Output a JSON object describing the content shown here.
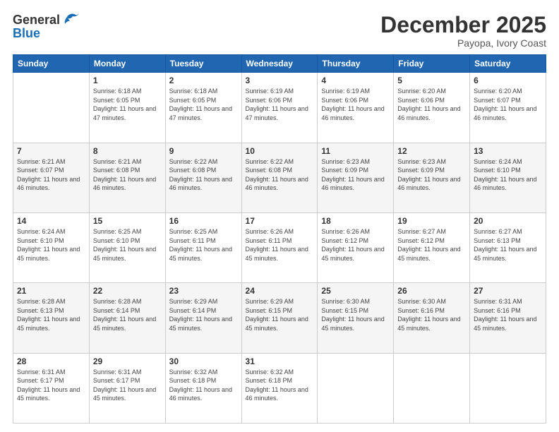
{
  "header": {
    "logo_general": "General",
    "logo_blue": "Blue",
    "month": "December 2025",
    "location": "Payopa, Ivory Coast"
  },
  "weekdays": [
    "Sunday",
    "Monday",
    "Tuesday",
    "Wednesday",
    "Thursday",
    "Friday",
    "Saturday"
  ],
  "weeks": [
    [
      {
        "day": "",
        "sunrise": "",
        "sunset": "",
        "daylight": ""
      },
      {
        "day": "1",
        "sunrise": "Sunrise: 6:18 AM",
        "sunset": "Sunset: 6:05 PM",
        "daylight": "Daylight: 11 hours and 47 minutes."
      },
      {
        "day": "2",
        "sunrise": "Sunrise: 6:18 AM",
        "sunset": "Sunset: 6:05 PM",
        "daylight": "Daylight: 11 hours and 47 minutes."
      },
      {
        "day": "3",
        "sunrise": "Sunrise: 6:19 AM",
        "sunset": "Sunset: 6:06 PM",
        "daylight": "Daylight: 11 hours and 47 minutes."
      },
      {
        "day": "4",
        "sunrise": "Sunrise: 6:19 AM",
        "sunset": "Sunset: 6:06 PM",
        "daylight": "Daylight: 11 hours and 46 minutes."
      },
      {
        "day": "5",
        "sunrise": "Sunrise: 6:20 AM",
        "sunset": "Sunset: 6:06 PM",
        "daylight": "Daylight: 11 hours and 46 minutes."
      },
      {
        "day": "6",
        "sunrise": "Sunrise: 6:20 AM",
        "sunset": "Sunset: 6:07 PM",
        "daylight": "Daylight: 11 hours and 46 minutes."
      }
    ],
    [
      {
        "day": "7",
        "sunrise": "Sunrise: 6:21 AM",
        "sunset": "Sunset: 6:07 PM",
        "daylight": "Daylight: 11 hours and 46 minutes."
      },
      {
        "day": "8",
        "sunrise": "Sunrise: 6:21 AM",
        "sunset": "Sunset: 6:08 PM",
        "daylight": "Daylight: 11 hours and 46 minutes."
      },
      {
        "day": "9",
        "sunrise": "Sunrise: 6:22 AM",
        "sunset": "Sunset: 6:08 PM",
        "daylight": "Daylight: 11 hours and 46 minutes."
      },
      {
        "day": "10",
        "sunrise": "Sunrise: 6:22 AM",
        "sunset": "Sunset: 6:08 PM",
        "daylight": "Daylight: 11 hours and 46 minutes."
      },
      {
        "day": "11",
        "sunrise": "Sunrise: 6:23 AM",
        "sunset": "Sunset: 6:09 PM",
        "daylight": "Daylight: 11 hours and 46 minutes."
      },
      {
        "day": "12",
        "sunrise": "Sunrise: 6:23 AM",
        "sunset": "Sunset: 6:09 PM",
        "daylight": "Daylight: 11 hours and 46 minutes."
      },
      {
        "day": "13",
        "sunrise": "Sunrise: 6:24 AM",
        "sunset": "Sunset: 6:10 PM",
        "daylight": "Daylight: 11 hours and 46 minutes."
      }
    ],
    [
      {
        "day": "14",
        "sunrise": "Sunrise: 6:24 AM",
        "sunset": "Sunset: 6:10 PM",
        "daylight": "Daylight: 11 hours and 45 minutes."
      },
      {
        "day": "15",
        "sunrise": "Sunrise: 6:25 AM",
        "sunset": "Sunset: 6:10 PM",
        "daylight": "Daylight: 11 hours and 45 minutes."
      },
      {
        "day": "16",
        "sunrise": "Sunrise: 6:25 AM",
        "sunset": "Sunset: 6:11 PM",
        "daylight": "Daylight: 11 hours and 45 minutes."
      },
      {
        "day": "17",
        "sunrise": "Sunrise: 6:26 AM",
        "sunset": "Sunset: 6:11 PM",
        "daylight": "Daylight: 11 hours and 45 minutes."
      },
      {
        "day": "18",
        "sunrise": "Sunrise: 6:26 AM",
        "sunset": "Sunset: 6:12 PM",
        "daylight": "Daylight: 11 hours and 45 minutes."
      },
      {
        "day": "19",
        "sunrise": "Sunrise: 6:27 AM",
        "sunset": "Sunset: 6:12 PM",
        "daylight": "Daylight: 11 hours and 45 minutes."
      },
      {
        "day": "20",
        "sunrise": "Sunrise: 6:27 AM",
        "sunset": "Sunset: 6:13 PM",
        "daylight": "Daylight: 11 hours and 45 minutes."
      }
    ],
    [
      {
        "day": "21",
        "sunrise": "Sunrise: 6:28 AM",
        "sunset": "Sunset: 6:13 PM",
        "daylight": "Daylight: 11 hours and 45 minutes."
      },
      {
        "day": "22",
        "sunrise": "Sunrise: 6:28 AM",
        "sunset": "Sunset: 6:14 PM",
        "daylight": "Daylight: 11 hours and 45 minutes."
      },
      {
        "day": "23",
        "sunrise": "Sunrise: 6:29 AM",
        "sunset": "Sunset: 6:14 PM",
        "daylight": "Daylight: 11 hours and 45 minutes."
      },
      {
        "day": "24",
        "sunrise": "Sunrise: 6:29 AM",
        "sunset": "Sunset: 6:15 PM",
        "daylight": "Daylight: 11 hours and 45 minutes."
      },
      {
        "day": "25",
        "sunrise": "Sunrise: 6:30 AM",
        "sunset": "Sunset: 6:15 PM",
        "daylight": "Daylight: 11 hours and 45 minutes."
      },
      {
        "day": "26",
        "sunrise": "Sunrise: 6:30 AM",
        "sunset": "Sunset: 6:16 PM",
        "daylight": "Daylight: 11 hours and 45 minutes."
      },
      {
        "day": "27",
        "sunrise": "Sunrise: 6:31 AM",
        "sunset": "Sunset: 6:16 PM",
        "daylight": "Daylight: 11 hours and 45 minutes."
      }
    ],
    [
      {
        "day": "28",
        "sunrise": "Sunrise: 6:31 AM",
        "sunset": "Sunset: 6:17 PM",
        "daylight": "Daylight: 11 hours and 45 minutes."
      },
      {
        "day": "29",
        "sunrise": "Sunrise: 6:31 AM",
        "sunset": "Sunset: 6:17 PM",
        "daylight": "Daylight: 11 hours and 45 minutes."
      },
      {
        "day": "30",
        "sunrise": "Sunrise: 6:32 AM",
        "sunset": "Sunset: 6:18 PM",
        "daylight": "Daylight: 11 hours and 46 minutes."
      },
      {
        "day": "31",
        "sunrise": "Sunrise: 6:32 AM",
        "sunset": "Sunset: 6:18 PM",
        "daylight": "Daylight: 11 hours and 46 minutes."
      },
      {
        "day": "",
        "sunrise": "",
        "sunset": "",
        "daylight": ""
      },
      {
        "day": "",
        "sunrise": "",
        "sunset": "",
        "daylight": ""
      },
      {
        "day": "",
        "sunrise": "",
        "sunset": "",
        "daylight": ""
      }
    ]
  ]
}
